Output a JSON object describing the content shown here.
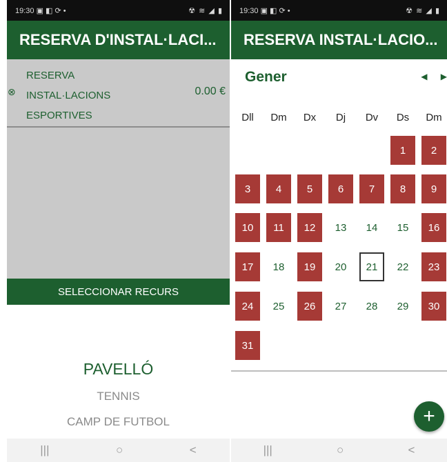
{
  "left": {
    "status_time": "19:30 ▣ ◧ ⟳ •",
    "status_right": "☢ ≋ ◢ ▮",
    "title": "RESERVA D'INSTAL·LACI...",
    "reservation": {
      "label_lines": [
        "RESERVA",
        "INSTAL·LACIONS",
        "ESPORTIVES"
      ],
      "price": "0.00 €"
    },
    "select_button": "SELECCIONAR RECURS",
    "resources": [
      "PAVELLÓ",
      "TENNIS",
      "CAMP DE FUTBOL"
    ],
    "nav": [
      "|||",
      "○",
      "<"
    ]
  },
  "right": {
    "status_time": "19:30 ▣ ◧ ⟳ •",
    "status_right": "☢ ≋ ◢ ▮",
    "title": "RESERVA INSTAL·LACIO...",
    "month": "Gener",
    "prev": "◀",
    "next": "▶",
    "weekdays": [
      "Dll",
      "Dm",
      "Dx",
      "Dj",
      "Dv",
      "Ds",
      "Dm"
    ],
    "first_weekday_index": 5,
    "booked_days": [
      1,
      2,
      3,
      4,
      5,
      6,
      7,
      8,
      9,
      10,
      11,
      12,
      16,
      17,
      19,
      23,
      24,
      26,
      30,
      31
    ],
    "selected_day": 21,
    "days": [
      "1",
      "2",
      "3",
      "4",
      "5",
      "6",
      "7",
      "8",
      "9",
      "10",
      "11",
      "12",
      "13",
      "14",
      "15",
      "16",
      "17",
      "18",
      "19",
      "20",
      "21",
      "22",
      "23",
      "24",
      "25",
      "26",
      "27",
      "28",
      "29",
      "30",
      "31"
    ],
    "fab_label": "+",
    "nav": [
      "|||",
      "○",
      "<"
    ]
  },
  "colors": {
    "primary": "#1d5f2f",
    "booked": "#a63a36",
    "gray": "#c9c9c9"
  }
}
